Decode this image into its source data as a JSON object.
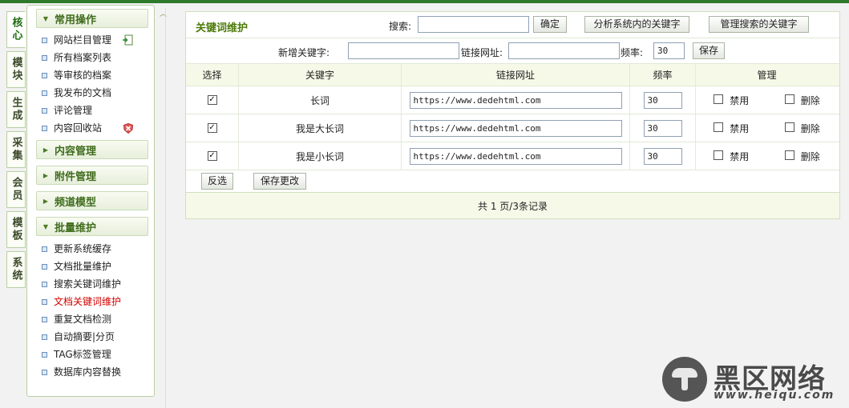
{
  "tabs": [
    "核心",
    "模块",
    "生成",
    "采集",
    "会员",
    "模板",
    "系统"
  ],
  "sidebar": {
    "group1": {
      "title": "常用操作",
      "items": [
        "网站栏目管理",
        "所有档案列表",
        "等审核的档案",
        "我发布的文档",
        "评论管理",
        "内容回收站"
      ]
    },
    "collapsed": [
      "内容管理",
      "附件管理",
      "频道模型"
    ],
    "group2": {
      "title": "批量维护",
      "items": [
        "更新系统缓存",
        "文档批量维护",
        "搜索关键词维护",
        "文档关键词维护",
        "重复文档检测",
        "自动摘要|分页",
        "TAG标签管理",
        "数据库内容替换"
      ]
    }
  },
  "main": {
    "title": "关键词维护",
    "search_label": "搜索:",
    "search_value": "",
    "confirm_btn": "确定",
    "analyze_btn": "分析系统内的关键字",
    "manage_search_btn": "管理搜索的关键字",
    "add_keyword_label": "新增关键字:",
    "add_keyword_value": "",
    "link_label": "链接网址:",
    "link_value": "",
    "freq_label": "频率:",
    "freq_value": "30",
    "save_btn": "保存",
    "headers": [
      "选择",
      "关键字",
      "链接网址",
      "频率",
      "管理"
    ],
    "rows": [
      {
        "keyword": "长词",
        "url": "https://www.dedehtml.com",
        "freq": "30",
        "disable": "禁用",
        "delete": "删除"
      },
      {
        "keyword": "我是大长词",
        "url": "https://www.dedehtml.com",
        "freq": "30",
        "disable": "禁用",
        "delete": "删除"
      },
      {
        "keyword": "我是小长词",
        "url": "https://www.dedehtml.com",
        "freq": "30",
        "disable": "禁用",
        "delete": "删除"
      }
    ],
    "invert_btn": "反选",
    "save_changes_btn": "保存更改",
    "footer": "共 1 页/3条记录"
  },
  "watermark": {
    "name": "黑区网络",
    "url": "www.heiqu.com"
  }
}
